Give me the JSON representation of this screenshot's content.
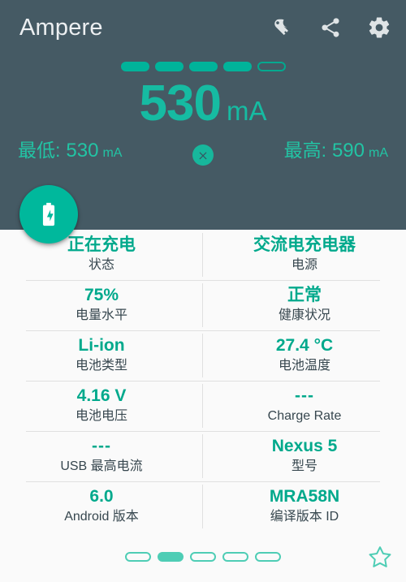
{
  "app": {
    "title": "Ampere",
    "accent_teal": "#00b89c",
    "header_bg": "#455a64",
    "body_bg": "#fafafa",
    "value_color": "#00a98c",
    "label_color": "#37474f"
  },
  "appbar": {
    "actions": [
      {
        "name": "key-icon",
        "label": "Key"
      },
      {
        "name": "share-icon",
        "label": "Share"
      },
      {
        "name": "gear-icon",
        "label": "Settings"
      }
    ]
  },
  "level_bar": {
    "segments_total": 5,
    "segments_filled": 4
  },
  "reading": {
    "value": "530",
    "unit": "mA"
  },
  "minmax": {
    "min_label": "最低:",
    "min_value": "530",
    "min_unit": "mA",
    "max_label": "最高:",
    "max_value": "590",
    "max_unit": "mA",
    "reset_icon": "close-circle-icon"
  },
  "fab": {
    "icon": "battery-charging-icon"
  },
  "info": {
    "rows": [
      [
        {
          "value": "正在充电",
          "label": "状态"
        },
        {
          "value": "交流电充电器",
          "label": "电源"
        }
      ],
      [
        {
          "value": "75%",
          "label": "电量水平"
        },
        {
          "value": "正常",
          "label": "健康状况"
        }
      ],
      [
        {
          "value": "Li-ion",
          "label": "电池类型"
        },
        {
          "value": "27.4 °C",
          "label": "电池温度"
        }
      ],
      [
        {
          "value": "4.16 V",
          "label": "电池电压"
        },
        {
          "value": "---",
          "label": "Charge Rate"
        }
      ],
      [
        {
          "value": "---",
          "label": "USB 最高电流"
        },
        {
          "value": "Nexus 5",
          "label": "型号"
        }
      ],
      [
        {
          "value": "6.0",
          "label": "Android 版本"
        },
        {
          "value": "MRA58N",
          "label": "编译版本 ID"
        }
      ]
    ]
  },
  "bottom": {
    "pager_total": 5,
    "pager_active_index": 1,
    "favorite_icon": "star-outline-icon"
  }
}
